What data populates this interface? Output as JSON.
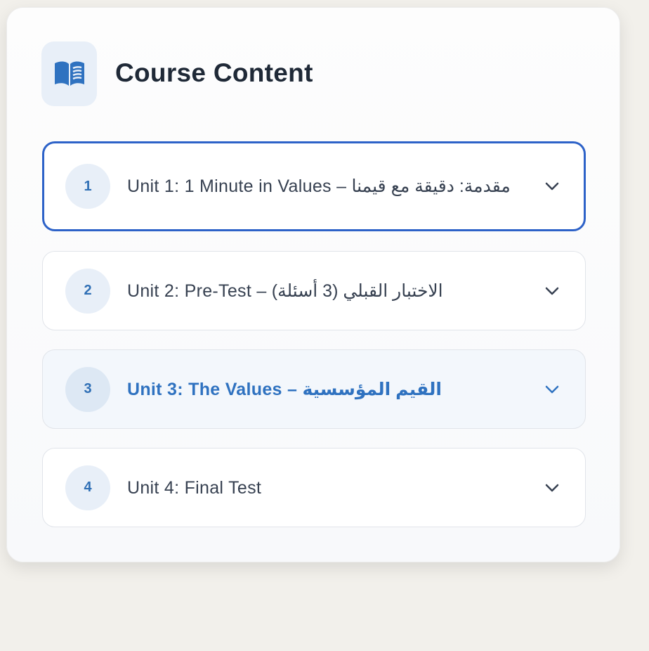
{
  "header": {
    "title": "Course Content",
    "icon": "book-open-icon"
  },
  "units": [
    {
      "number": "1",
      "label": "Unit 1: 1 Minute in Values – مقدمة: دقيقة مع قيمنا",
      "state": "focused"
    },
    {
      "number": "2",
      "label": "Unit 2: Pre-Test – الاختبار القبلي (3 أسئلة)",
      "state": "normal"
    },
    {
      "number": "3",
      "label": "Unit 3: The Values – القيم المؤسسية",
      "state": "active"
    },
    {
      "number": "4",
      "label": "Unit 4: Final Test",
      "state": "normal"
    }
  ],
  "colors": {
    "accent": "#2f72c0",
    "focus": "#2d62c8",
    "text": "#374151",
    "title": "#1f2937"
  }
}
